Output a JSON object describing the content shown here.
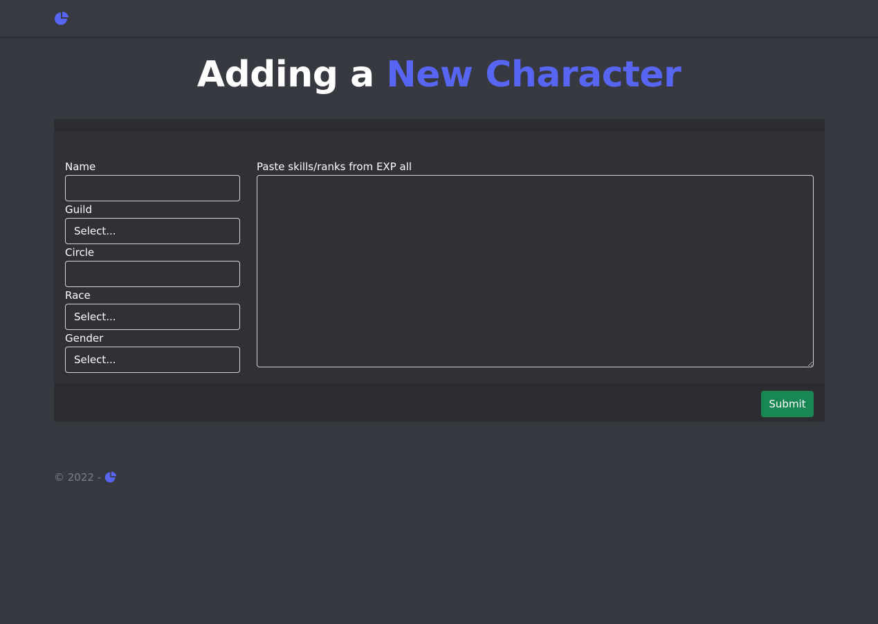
{
  "navbar": {
    "logo_icon": "pie-chart-icon"
  },
  "heading": {
    "part1": "Adding a ",
    "part2": "New Character"
  },
  "form": {
    "name_label": "Name",
    "name_value": "",
    "guild_label": "Guild",
    "guild_value": "Select...",
    "circle_label": "Circle",
    "circle_value": "",
    "race_label": "Race",
    "race_value": "Select...",
    "gender_label": "Gender",
    "gender_value": "Select...",
    "skills_label": "Paste skills/ranks from EXP all",
    "skills_value": "",
    "submit_label": "Submit"
  },
  "footer": {
    "text": "© 2022 -",
    "logo_icon": "pie-chart-icon"
  },
  "colors": {
    "background": "#36393f",
    "card": "#2f3136",
    "accent": "#5865f2",
    "submit": "#198754",
    "footer_text": "#7b7f87"
  }
}
